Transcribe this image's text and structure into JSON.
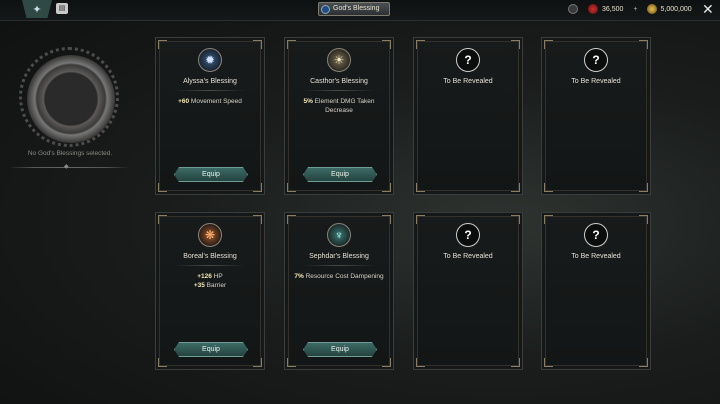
{
  "header": {
    "title": "God's Blessing",
    "currency1": "36,500",
    "currency2": "5,000,000",
    "plus": "+",
    "close": "✕"
  },
  "sidebar": {
    "no_selection": "No God's Blessings selected."
  },
  "cards": [
    {
      "name": "Alyssa's Blessing",
      "stat1_val": "+60",
      "stat1_text": " Movement Speed",
      "stat2_val": "",
      "stat2_text": "",
      "button": "Equip",
      "icon": "compass-star-icon"
    },
    {
      "name": "Casthor's Blessing",
      "stat1_val": "5%",
      "stat1_text": " Element DMG Taken Decrease",
      "stat2_val": "",
      "stat2_text": "",
      "button": "Equip",
      "icon": "winged-sun-icon"
    },
    {
      "name": "To Be Revealed",
      "icon": "question-mark-icon"
    },
    {
      "name": "To Be Revealed",
      "icon": "question-mark-icon"
    },
    {
      "name": "Boreal's Blessing",
      "stat1_val": "+126",
      "stat1_text": " HP",
      "stat2_val": "+35",
      "stat2_text": " Barrier",
      "button": "Equip",
      "icon": "flame-tree-icon"
    },
    {
      "name": "Sephdar's Blessing",
      "stat1_val": "7%",
      "stat1_text": " Resource Cost Dampening",
      "stat2_val": "",
      "stat2_text": "",
      "button": "Equip",
      "icon": "spirit-figure-icon"
    },
    {
      "name": "To Be Revealed",
      "icon": "question-mark-icon"
    },
    {
      "name": "To Be Revealed",
      "icon": "question-mark-icon"
    }
  ],
  "colors": {
    "equip_button": "#2e5a56",
    "corner_trim": "#8a7e62",
    "highlight_value": "#f3e9b8"
  }
}
